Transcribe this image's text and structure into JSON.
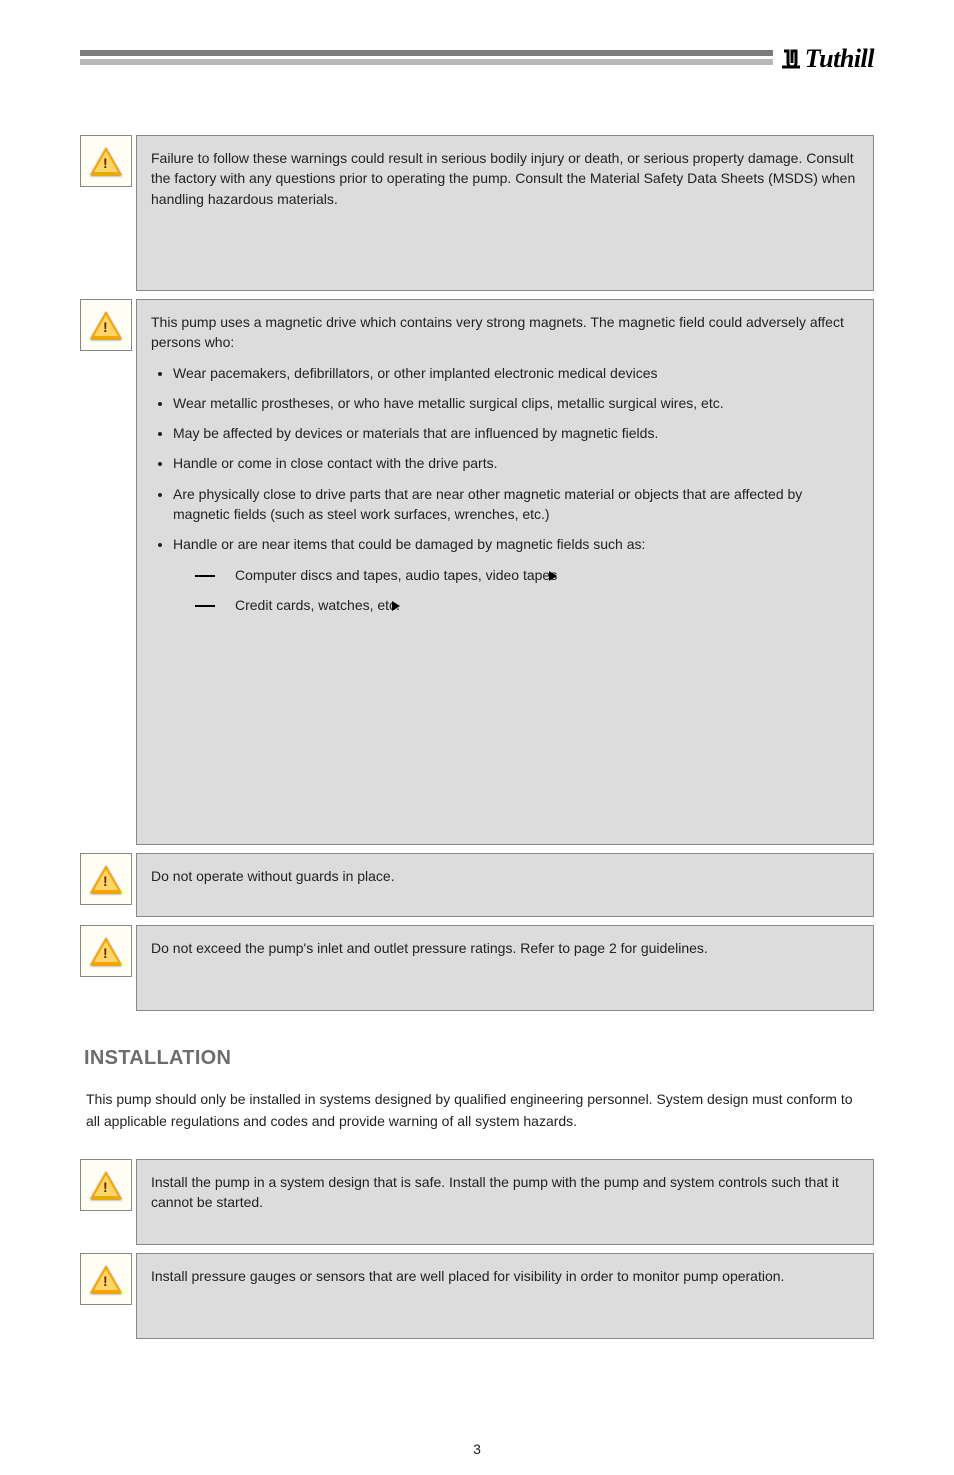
{
  "logo_text": "Tuthill",
  "page_number": "3",
  "section2_title": "INSTALLATION",
  "section2_prelude": "This pump should only be installed in systems designed by qualified engineering personnel. System design must conform to all applicable regulations and codes and provide warning of all system hazards.",
  "warnings": [
    {
      "id": "w1",
      "h": "h130",
      "body": "Failure to follow these warnings could result in serious bodily injury or death, or serious property damage. Consult the factory with any questions prior to operating the pump. Consult the Material Safety Data Sheets (MSDS) when handling hazardous materials."
    },
    {
      "id": "w2",
      "h": "h520",
      "lead": "This pump uses a magnetic drive which contains very strong magnets. The magnetic field could adversely affect persons who:",
      "bullets": [
        "Wear pacemakers, defibrillators, or other implanted electronic medical devices",
        "Wear metallic prostheses, or who have metallic surgical clips, metallic surgical wires, etc.",
        "May be affected by devices or materials that are influenced by magnetic fields.",
        "Handle or come in close contact with the drive parts.",
        "Are physically close to drive parts that are near other magnetic material or objects that are affected by magnetic fields (such as steel work surfaces, wrenches, etc.)",
        "Handle or are near items that could be damaged by magnetic fields such as:"
      ],
      "subitems": [
        "Computer discs and tapes, audio tapes, video tapes",
        "Credit cards, watches, etc."
      ]
    },
    {
      "id": "w3",
      "h": "h38",
      "body": "Do not operate without guards in place."
    },
    {
      "id": "w4",
      "h": "h60",
      "body": "Do not exceed the pump's inlet and outlet pressure ratings. Refer to page 2 for guidelines."
    },
    {
      "id": "w5",
      "h": "h60",
      "body": "Install the pump in a system design that is safe. Install the pump with the pump and system controls such that it cannot be started."
    },
    {
      "id": "w6",
      "h": "h60",
      "body": "Install pressure gauges or sensors that are well placed for visibility in order to monitor pump operation."
    }
  ]
}
